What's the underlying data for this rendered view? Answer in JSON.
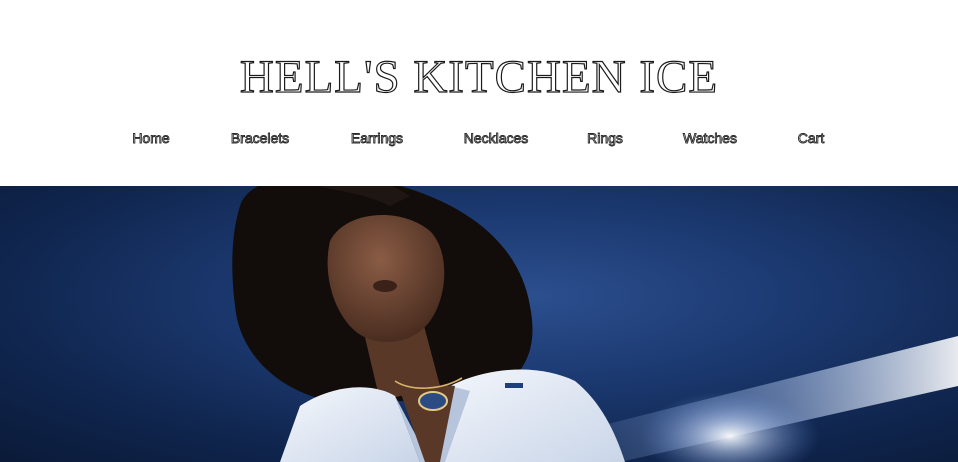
{
  "site": {
    "title": "HELL'S KITCHEN ICE"
  },
  "nav": {
    "items": [
      {
        "label": "Home"
      },
      {
        "label": "Bracelets"
      },
      {
        "label": "Earrings"
      },
      {
        "label": "Necklaces"
      },
      {
        "label": "Rings"
      },
      {
        "label": "Watches"
      },
      {
        "label": "Cart"
      }
    ]
  },
  "colors": {
    "page_background": "#ffffff",
    "hero_background": "#1c3a72",
    "jacket": "#e8eef6",
    "skin": "#6b4634",
    "hair": "#120d0b",
    "pendant": "#2a4c82"
  }
}
